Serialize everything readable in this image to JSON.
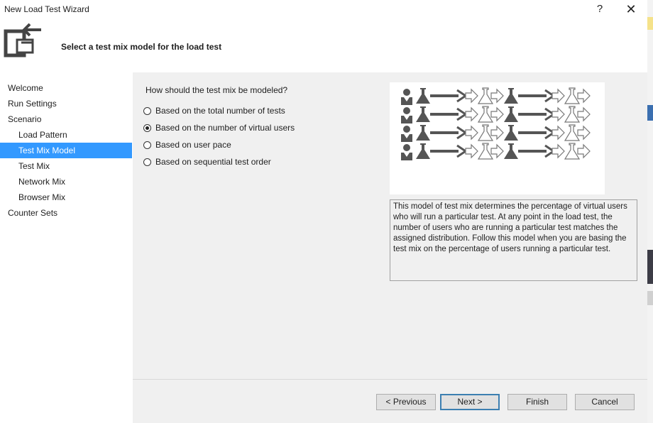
{
  "window": {
    "title": "New Load Test Wizard",
    "help_glyph": "?",
    "close_glyph": "✕"
  },
  "header": {
    "title": "Select a test mix model for the load test",
    "icon": "wizard-arrow-icon"
  },
  "nav": {
    "items": [
      {
        "label": "Welcome",
        "sub": false,
        "selected": false
      },
      {
        "label": "Run Settings",
        "sub": false,
        "selected": false
      },
      {
        "label": "Scenario",
        "sub": false,
        "selected": false
      },
      {
        "label": "Load Pattern",
        "sub": true,
        "selected": false
      },
      {
        "label": "Test Mix Model",
        "sub": true,
        "selected": true
      },
      {
        "label": "Test Mix",
        "sub": true,
        "selected": false
      },
      {
        "label": "Network Mix",
        "sub": true,
        "selected": false
      },
      {
        "label": "Browser Mix",
        "sub": true,
        "selected": false
      },
      {
        "label": "Counter Sets",
        "sub": false,
        "selected": false
      }
    ]
  },
  "main": {
    "question": "How should the test mix be modeled?",
    "options": [
      {
        "label": "Based on the total number of tests",
        "checked": false
      },
      {
        "label": "Based on the number of virtual users",
        "checked": true
      },
      {
        "label": "Based on user pace",
        "checked": false
      },
      {
        "label": "Based on sequential test order",
        "checked": false
      }
    ],
    "description": "This model of test mix determines the percentage of virtual users who will run a particular test. At any point in the load test, the number of users who are running a particular test matches the assigned distribution. Follow this model when you are basing the test mix on the percentage of users running a particular test.",
    "illustration_icons": [
      "user-icon",
      "flask-icon",
      "arrow-icon"
    ]
  },
  "buttons": {
    "previous": "< Previous",
    "next": "Next >",
    "finish": "Finish",
    "cancel": "Cancel"
  },
  "colors": {
    "selection": "#3399ff",
    "panel": "#f0f0f0",
    "icon_gray": "#555555"
  }
}
